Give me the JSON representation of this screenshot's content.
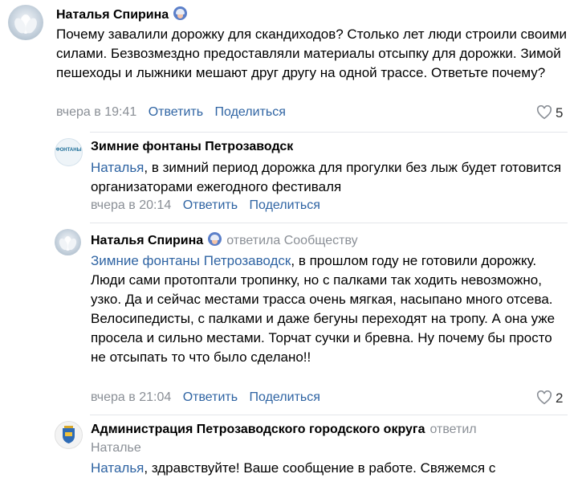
{
  "comments": [
    {
      "author": "Наталья Спирина",
      "text": "Почему завалили дорожку для скандиходов? Столько лет люди строили своими силами. Безвозмездно предоставляли материалы отсыпку для дорожки. Зимой пешеходы и лыжники мешают друг другу на одной трассе. Ответьте почему?",
      "time": "вчера в 19:41",
      "reply_label": "Ответить",
      "share_label": "Поделиться",
      "likes": "5"
    },
    {
      "author": "Зимние фонтаны Петрозаводск",
      "avatar_text": "ФОНТАНЫ",
      "mention": "Наталья",
      "text": ", в зимний период дорожка для прогулки без лыж будет готовится организаторами ежегодного фестиваля",
      "time": "вчера в 20:14",
      "reply_label": "Ответить",
      "share_label": "Поделиться"
    },
    {
      "author": "Наталья Спирина",
      "reply_to": "ответила Сообществу",
      "mention": "Зимние фонтаны Петрозаводск",
      "text": ", в прошлом году не готовили дорожку. Люди сами протоптали тропинку, но с палками так ходить невозможно, узко. Да и сейчас местами трасса очень мягкая, насыпано много отсева. Велосипедисты, с палками и даже бегуны переходят на тропу. А она уже просела и сильно местами. Торчат сучки и бревна. Ну почему бы просто не отсыпать то что было сделано!!",
      "time": "вчера в 21:04",
      "reply_label": "Ответить",
      "share_label": "Поделиться",
      "likes": "2"
    },
    {
      "author": "Администрация Петрозаводского городского округа",
      "reply_to": "ответил",
      "reply_to_target": "Наталье",
      "mention": "Наталья",
      "text": ", здравствуйте! Ваше сообщение в работе. Свяжемся с"
    }
  ],
  "colors": {
    "link": "#2f64a3",
    "muted": "#8a8f96",
    "divider": "#e4e6ea"
  },
  "icons": {
    "like": "heart-icon",
    "badge": "user-badge-icon"
  }
}
